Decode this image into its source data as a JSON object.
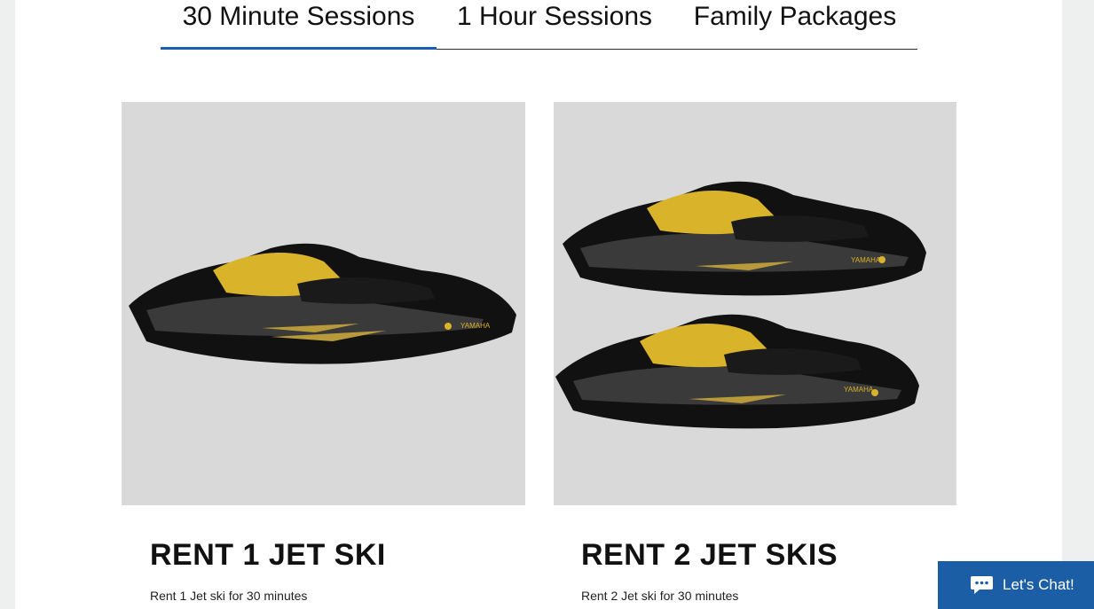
{
  "tabs": [
    {
      "label": "30 Minute Sessions",
      "active": true
    },
    {
      "label": "1 Hour Sessions",
      "active": false
    },
    {
      "label": "Family Packages",
      "active": false
    }
  ],
  "products": [
    {
      "title": "RENT 1 JET SKI",
      "description": "Rent 1 Jet ski for 30 minutes",
      "image": "jet-ski-image",
      "brand": "YAMAHA"
    },
    {
      "title": "RENT 2 JET SKIS",
      "description": "Rent 2 Jet ski for 30 minutes",
      "image": "two-jet-skis-image",
      "brand": "YAMAHA"
    }
  ],
  "chat": {
    "label": "Let's Chat!",
    "icon": "chat-bubble-icon"
  },
  "colors": {
    "accent": "#1a5fb4",
    "chat_bg": "#1b5ea6",
    "image_bg": "#d9d9d9",
    "hull": "#111111",
    "gold": "#d9b32a"
  }
}
